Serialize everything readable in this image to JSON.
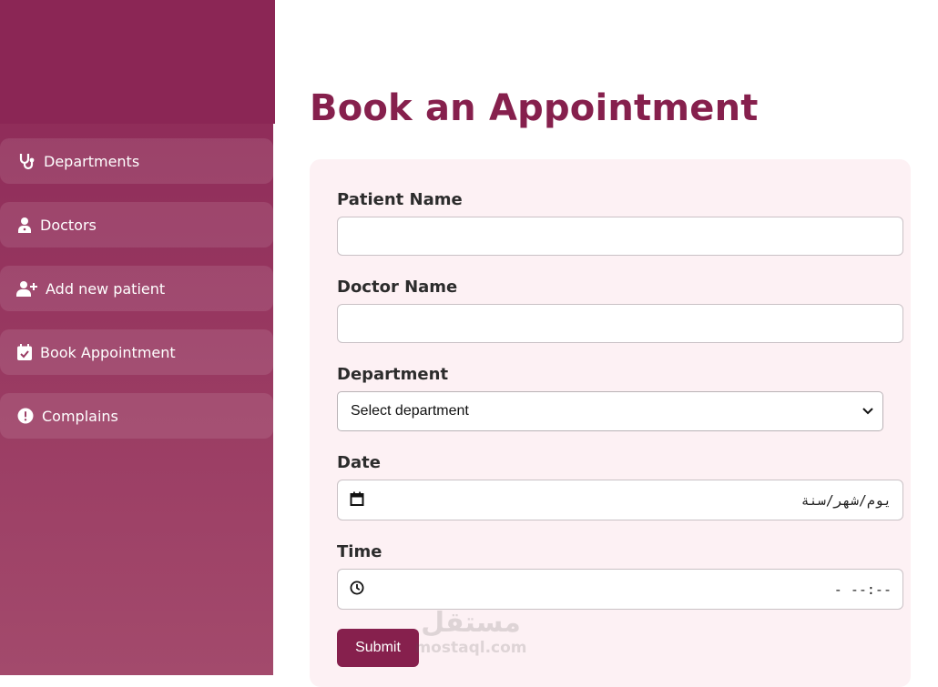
{
  "sidebar": {
    "items": [
      {
        "label": "Departments",
        "icon": "stethoscope-icon"
      },
      {
        "label": "Doctors",
        "icon": "user-doctor-icon"
      },
      {
        "label": "Add new patient",
        "icon": "user-plus-icon"
      },
      {
        "label": "Book Appointment",
        "icon": "calendar-check-icon"
      },
      {
        "label": "Complains",
        "icon": "exclamation-circle-icon"
      }
    ]
  },
  "main": {
    "title": "Book an Appointment",
    "form": {
      "patient_name_label": "Patient Name",
      "patient_name_value": "",
      "doctor_name_label": "Doctor Name",
      "doctor_name_value": "",
      "department_label": "Department",
      "department_selected": "Select department",
      "date_label": "Date",
      "date_placeholder": "يوم/شهر/سنة",
      "time_label": "Time",
      "time_placeholder": "--:-- -",
      "submit_label": "Submit"
    }
  },
  "watermark": {
    "logo": "مستقل",
    "site": "mostaql.com"
  },
  "colors": {
    "brand": "#86204d",
    "sidebar_top": "#8b2655",
    "sidebar_bottom": "#a34a6c",
    "card_bg": "#fdf1f4"
  }
}
